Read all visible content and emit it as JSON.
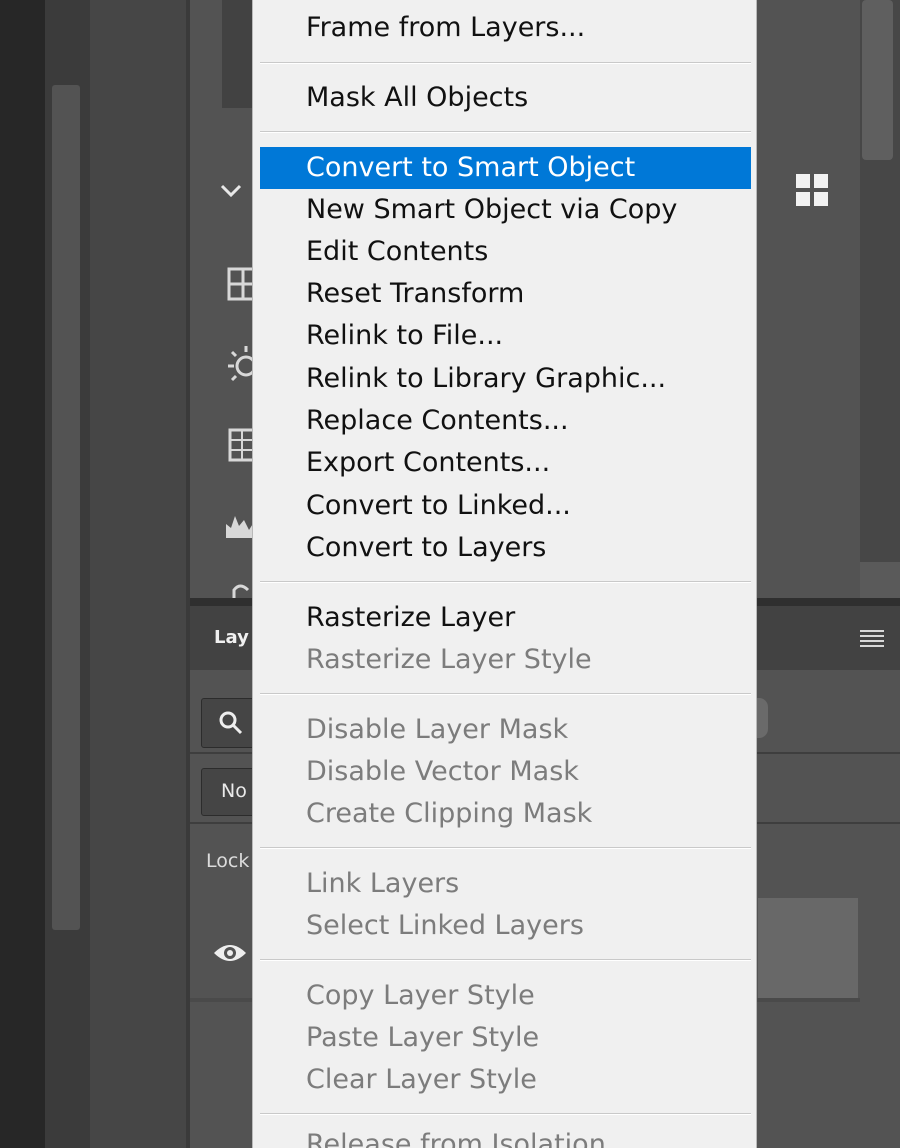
{
  "layers_panel": {
    "tab_label": "Lay",
    "blend_mode_value": "No",
    "lock_label": "Lock"
  },
  "icons": {
    "collapse": "chevron-down-icon",
    "properties_sidebar": [
      "transform-icon",
      "brightness-icon",
      "table-icon",
      "histogram-icon",
      "adjustment-icon"
    ],
    "view_toggle": "grid-icon",
    "panel_menu": "hamburger-menu-icon",
    "layer_visibility": "eye-icon",
    "layer_search": "search-icon"
  },
  "context_menu": {
    "highlight_color": "#0078d7",
    "items": [
      {
        "label": "Frame from Layers...",
        "enabled": true
      },
      {
        "label": "Mask All Objects",
        "enabled": true
      },
      {
        "label": "Convert to Smart Object",
        "enabled": true,
        "highlighted": true
      },
      {
        "label": "New Smart Object via Copy",
        "enabled": true
      },
      {
        "label": "Edit Contents",
        "enabled": true
      },
      {
        "label": "Reset Transform",
        "enabled": true
      },
      {
        "label": "Relink to File...",
        "enabled": true
      },
      {
        "label": "Relink to Library Graphic...",
        "enabled": true
      },
      {
        "label": "Replace Contents...",
        "enabled": true
      },
      {
        "label": "Export Contents...",
        "enabled": true
      },
      {
        "label": "Convert to Linked...",
        "enabled": true
      },
      {
        "label": "Convert to Layers",
        "enabled": true
      },
      {
        "label": "Rasterize Layer",
        "enabled": true
      },
      {
        "label": "Rasterize Layer Style",
        "enabled": false
      },
      {
        "label": "Disable Layer Mask",
        "enabled": false
      },
      {
        "label": "Disable Vector Mask",
        "enabled": false
      },
      {
        "label": "Create Clipping Mask",
        "enabled": false
      },
      {
        "label": "Link Layers",
        "enabled": false
      },
      {
        "label": "Select Linked Layers",
        "enabled": false
      },
      {
        "label": "Copy Layer Style",
        "enabled": false
      },
      {
        "label": "Paste Layer Style",
        "enabled": false
      },
      {
        "label": "Clear Layer Style",
        "enabled": false
      },
      {
        "label": "Release from Isolation",
        "enabled": false
      }
    ]
  }
}
